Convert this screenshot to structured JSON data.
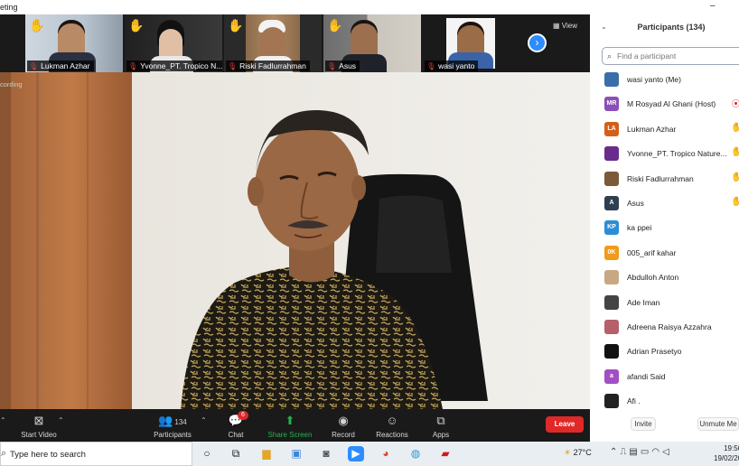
{
  "window": {
    "title": "eting",
    "minimize": "–"
  },
  "meeting": {
    "view_label": "View",
    "next_icon": "›",
    "recording_label": "cording",
    "thumbnails": [
      {
        "name": "Lukman Azhar",
        "hand_raised": true
      },
      {
        "name": "Yvonne_PT. Tropico N...",
        "hand_raised": true
      },
      {
        "name": "Riski Fadlurrahman",
        "hand_raised": true
      },
      {
        "name": "Asus",
        "hand_raised": true
      },
      {
        "name": "wasi yanto",
        "hand_raised": false
      }
    ]
  },
  "toolbar": {
    "start_video": "Start Video",
    "participants": "Participants",
    "participants_count": "134",
    "chat": "Chat",
    "chat_badge": "6",
    "share_screen": "Share Screen",
    "record": "Record",
    "reactions": "Reactions",
    "apps": "Apps",
    "leave": "Leave"
  },
  "participants_panel": {
    "title": "Participants (134)",
    "search_placeholder": "Find a participant",
    "invite_label": "Invite",
    "unmute_label": "Unmute Me",
    "items": [
      {
        "name": "wasi yanto (Me)",
        "initials": "",
        "color": "#3b6ea8",
        "status": ""
      },
      {
        "name": "M Rosyad Al Ghani (Host)",
        "initials": "MR",
        "color": "#8a4fb8",
        "status": "recording"
      },
      {
        "name": "Lukman Azhar",
        "initials": "LA",
        "color": "#d45f1a",
        "status": "hand"
      },
      {
        "name": "Yvonne_PT. Tropico Nature...",
        "initials": "",
        "color": "#6a2c8c",
        "status": "hand"
      },
      {
        "name": "Riski Fadlurrahman",
        "initials": "",
        "color": "#7b5a3a",
        "status": "hand"
      },
      {
        "name": "Asus",
        "initials": "A",
        "color": "#2f3f52",
        "status": "hand"
      },
      {
        "name": "ka ppei",
        "initials": "KP",
        "color": "#2a8ed6",
        "status": ""
      },
      {
        "name": "005_arif kahar",
        "initials": "0K",
        "color": "#f29a1a",
        "status": ""
      },
      {
        "name": "Abdulloh Anton",
        "initials": "",
        "color": "#c8a882",
        "status": ""
      },
      {
        "name": "Ade Iman",
        "initials": "",
        "color": "#444444",
        "status": ""
      },
      {
        "name": "Adreena Raisya Azzahra",
        "initials": "",
        "color": "#b5606a",
        "status": ""
      },
      {
        "name": "Adrian Prasetyo",
        "initials": "",
        "color": "#111111",
        "status": ""
      },
      {
        "name": "afandi Said",
        "initials": "a",
        "color": "#a24fc4",
        "status": ""
      },
      {
        "name": "Afi .",
        "initials": "",
        "color": "#222222",
        "status": ""
      }
    ]
  },
  "taskbar": {
    "search_placeholder": "Type here to search",
    "temperature": "27°C",
    "time": "19:56",
    "date": "19/02/20"
  }
}
